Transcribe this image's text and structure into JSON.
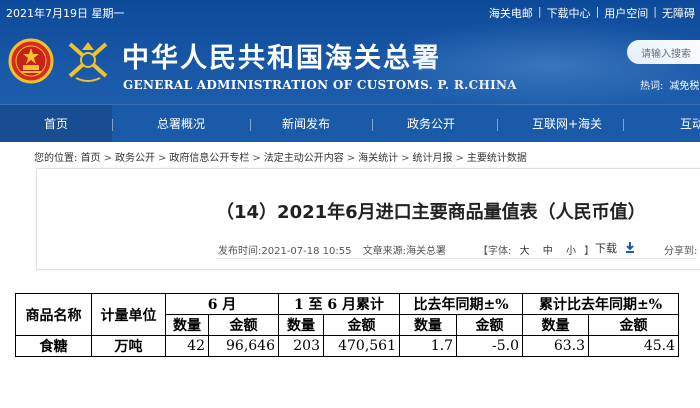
{
  "header": {
    "date": "2021年7月19日 星期一",
    "top_links": [
      "海关电邮",
      "下载中心",
      "用户空间",
      "无障碍"
    ],
    "title_cn": "中华人民共和国海关总署",
    "title_en": "GENERAL ADMINISTRATION OF CUSTOMS. P. R.CHINA",
    "search_placeholder": "请输入搜索",
    "hot_label": "热词:",
    "hot_word": "减免税"
  },
  "nav": {
    "items": [
      "首页",
      "总署概况",
      "新闻发布",
      "政务公开",
      "互联网+海关",
      "互动"
    ]
  },
  "breadcrumb": {
    "label": "您的位置:",
    "items": [
      "首页",
      "政务公开",
      "政府信息公开专栏",
      "法定主动公开内容",
      "海关统计",
      "统计月报",
      "主要统计数据"
    ]
  },
  "article": {
    "title": "（14）2021年6月进口主要商品量值表（人民币值）",
    "publish_label": "发布时间:",
    "publish_time": "2021-07-18 10:55",
    "source_label": "文章来源:",
    "source": "海关总署",
    "font_label": "【字体:",
    "font_sizes": [
      "大",
      "中",
      "小"
    ],
    "font_close": "】",
    "download_label": "下载",
    "share_label": "分享到:"
  },
  "table": {
    "header_row1": [
      "商品名称",
      "计量单位",
      "6 月",
      "1 至 6 月累计",
      "比去年同期±%",
      "累计比去年同期±%"
    ],
    "header_row2": [
      "数量",
      "金额",
      "数量",
      "金额",
      "数量",
      "金额",
      "数量",
      "金额"
    ],
    "rows": [
      [
        "食糖",
        "万吨",
        "42",
        "96,646",
        "203",
        "470,561",
        "1.7",
        "-5.0",
        "63.3",
        "45.4"
      ]
    ]
  },
  "colors": {
    "header_blue": "#1a5aa8",
    "nav_active": "#184d92"
  }
}
